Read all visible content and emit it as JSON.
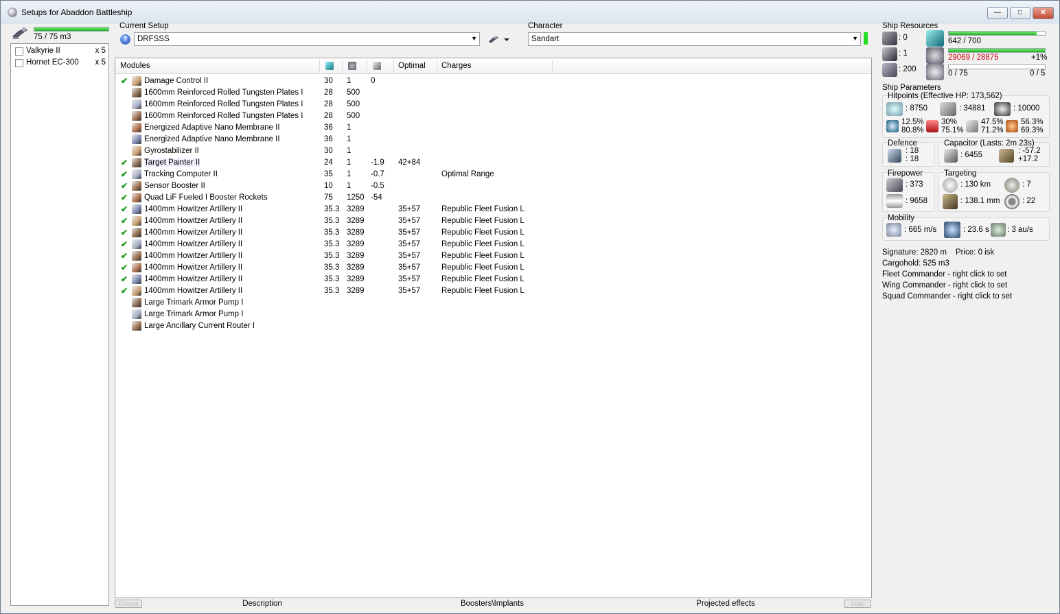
{
  "window": {
    "title": "Setups for Abaddon Battleship",
    "min_label": "—",
    "max_label": "□",
    "close_label": "✕"
  },
  "drones": {
    "bay_text": "75 / 75 m3",
    "bay_fill": 1.0,
    "items": [
      {
        "name": "Valkyrie II",
        "qty": "x 5"
      },
      {
        "name": "Hornet EC-300",
        "qty": "x 5"
      }
    ]
  },
  "setup": {
    "label": "Current Setup",
    "value": "DRFSSS",
    "help": "?"
  },
  "character": {
    "label": "Character",
    "value": "Sandart"
  },
  "modules": {
    "headers": {
      "name": "Modules",
      "optimal": "Optimal",
      "charges": "Charges"
    },
    "rows": [
      {
        "check": "✔",
        "name": "Damage Control II",
        "c1": "30",
        "c2": "1",
        "c3": "0",
        "c4": "",
        "c5": ""
      },
      {
        "check": "",
        "name": "1600mm Reinforced Rolled Tungsten Plates I",
        "c1": "28",
        "c2": "500",
        "c3": "",
        "c4": "",
        "c5": ""
      },
      {
        "check": "",
        "name": "1600mm Reinforced Rolled Tungsten Plates I",
        "c1": "28",
        "c2": "500",
        "c3": "",
        "c4": "",
        "c5": ""
      },
      {
        "check": "",
        "name": "1600mm Reinforced Rolled Tungsten Plates I",
        "c1": "28",
        "c2": "500",
        "c3": "",
        "c4": "",
        "c5": ""
      },
      {
        "check": "",
        "name": "Energized Adaptive Nano Membrane II",
        "c1": "36",
        "c2": "1",
        "c3": "",
        "c4": "",
        "c5": ""
      },
      {
        "check": "",
        "name": "Energized Adaptive Nano Membrane II",
        "c1": "36",
        "c2": "1",
        "c3": "",
        "c4": "",
        "c5": ""
      },
      {
        "check": "",
        "name": "Gyrostabilizer II",
        "c1": "30",
        "c2": "1",
        "c3": "",
        "c4": "",
        "c5": ""
      },
      {
        "check": "✔",
        "name": "Target Painter II",
        "c1": "24",
        "c2": "1",
        "c3": "-1.9",
        "c4": "42+84",
        "c5": ""
      },
      {
        "check": "✔",
        "name": "Tracking Computer II",
        "c1": "35",
        "c2": "1",
        "c3": "-0.7",
        "c4": "",
        "c5": "Optimal Range"
      },
      {
        "check": "✔",
        "name": "Sensor Booster II",
        "c1": "10",
        "c2": "1",
        "c3": "-0.5",
        "c4": "",
        "c5": ""
      },
      {
        "check": "✔",
        "name": "Quad LiF Fueled I Booster Rockets",
        "c1": "75",
        "c2": "1250",
        "c3": "-54",
        "c4": "",
        "c5": ""
      },
      {
        "check": "✔",
        "name": "1400mm Howitzer Artillery II",
        "c1": "35.3",
        "c2": "3289",
        "c3": "",
        "c4": "35+57",
        "c5": "Republic Fleet Fusion L"
      },
      {
        "check": "✔",
        "name": "1400mm Howitzer Artillery II",
        "c1": "35.3",
        "c2": "3289",
        "c3": "",
        "c4": "35+57",
        "c5": "Republic Fleet Fusion L"
      },
      {
        "check": "✔",
        "name": "1400mm Howitzer Artillery II",
        "c1": "35.3",
        "c2": "3289",
        "c3": "",
        "c4": "35+57",
        "c5": "Republic Fleet Fusion L"
      },
      {
        "check": "✔",
        "name": "1400mm Howitzer Artillery II",
        "c1": "35.3",
        "c2": "3289",
        "c3": "",
        "c4": "35+57",
        "c5": "Republic Fleet Fusion L"
      },
      {
        "check": "✔",
        "name": "1400mm Howitzer Artillery II",
        "c1": "35.3",
        "c2": "3289",
        "c3": "",
        "c4": "35+57",
        "c5": "Republic Fleet Fusion L"
      },
      {
        "check": "✔",
        "name": "1400mm Howitzer Artillery II",
        "c1": "35.3",
        "c2": "3289",
        "c3": "",
        "c4": "35+57",
        "c5": "Republic Fleet Fusion L"
      },
      {
        "check": "✔",
        "name": "1400mm Howitzer Artillery II",
        "c1": "35.3",
        "c2": "3289",
        "c3": "",
        "c4": "35+57",
        "c5": "Republic Fleet Fusion L"
      },
      {
        "check": "✔",
        "name": "1400mm Howitzer Artillery II",
        "c1": "35.3",
        "c2": "3289",
        "c3": "",
        "c4": "35+57",
        "c5": "Republic Fleet Fusion L"
      },
      {
        "check": "",
        "name": "Large Trimark Armor Pump I",
        "c1": "",
        "c2": "",
        "c3": "",
        "c4": "",
        "c5": ""
      },
      {
        "check": "",
        "name": "Large Trimark Armor Pump I",
        "c1": "",
        "c2": "",
        "c3": "",
        "c4": "",
        "c5": ""
      },
      {
        "check": "",
        "name": "Large Ancillary Current Router I",
        "c1": "",
        "c2": "",
        "c3": "",
        "c4": "",
        "c5": ""
      }
    ]
  },
  "bottom_tabs": {
    "drones_btn": "Drones",
    "description": "Description",
    "boosters": "Boosters\\Implants",
    "projected": "Projected effects",
    "stats_btn": "Stats"
  },
  "resources": {
    "title": "Ship Resources",
    "turrets": ": 0",
    "launchers": ": 1",
    "calibration": ": 200",
    "cpu": "642 / 700",
    "cpu_fill": 0.917,
    "power": "29069 / 28875",
    "power_fill": 1.0,
    "power_pct": "+1%",
    "drone_bw": "0 / 75",
    "drone_active": "0 / 5"
  },
  "params": {
    "title": "Ship Parameters",
    "hitpoints_title": "Hitpoints (Effective HP: 173,562)",
    "shield_hp": ": 8750",
    "armor_hp": ": 34881",
    "hull_hp": ": 10000",
    "res_em": [
      "12.5%",
      "80.8%"
    ],
    "res_thermal": [
      "30%",
      "75.1%"
    ],
    "res_kinetic": [
      "47.5%",
      "71.2%"
    ],
    "res_explosive": [
      "56.3%",
      "69.3%"
    ],
    "defence_title": "Defence",
    "defence_a": ": 18",
    "defence_b": ": 18",
    "capacitor_title": "Capacitor (Lasts: 2m 23s)",
    "cap_amount": ": 6455",
    "cap_a": ": -57.2",
    "cap_b": "+17.2",
    "firepower_title": "Firepower",
    "dps": ": 373",
    "volley": ": 9658",
    "targeting_title": "Targeting",
    "range": ": 130 km",
    "max_targets": ": 7",
    "scan_res": ": 138.1 mm",
    "sensor": ": 22",
    "mobility_title": "Mobility",
    "speed": ": 665 m/s",
    "align": ": 23.6 s",
    "warp": ": 3 au/s",
    "signature": "Signature: 2820 m",
    "price": "Price: 0 isk",
    "cargohold": "Cargohold: 525 m3",
    "fleet_cmd": "Fleet Commander - right click to set",
    "wing_cmd": "Wing Commander - right click to set",
    "squad_cmd": "Squad Commander - right click to set"
  }
}
